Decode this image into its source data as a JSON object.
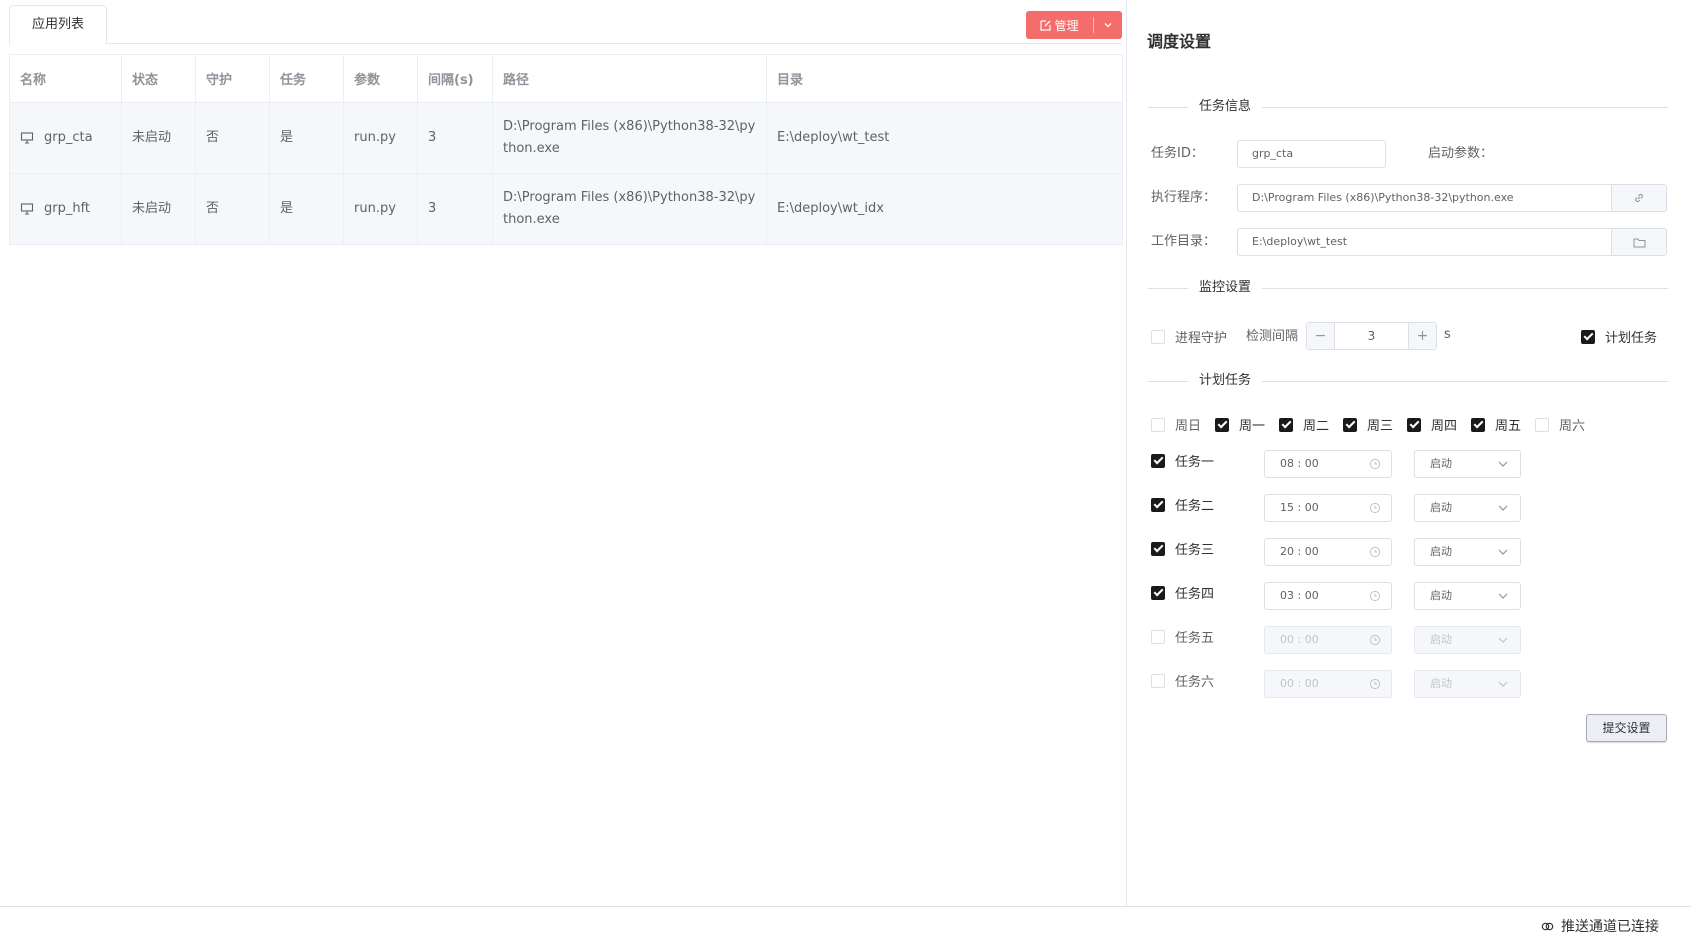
{
  "tabs": {
    "app_list": "应用列表"
  },
  "toolbar": {
    "manage_label": "管理"
  },
  "table": {
    "headers": [
      "名称",
      "状态",
      "守护",
      "任务",
      "参数",
      "间隔(s)",
      "路径",
      "目录"
    ],
    "rows": [
      {
        "name": "grp_cta",
        "status": "未启动",
        "guard": "否",
        "task": "是",
        "params": "run.py",
        "interval": "3",
        "path": "D:\\Program Files (x86)\\Python38-32\\python.exe",
        "dir": "E:\\deploy\\wt_test"
      },
      {
        "name": "grp_hft",
        "status": "未启动",
        "guard": "否",
        "task": "是",
        "params": "run.py",
        "interval": "3",
        "path": "D:\\Program Files (x86)\\Python38-32\\python.exe",
        "dir": "E:\\deploy\\wt_idx"
      }
    ]
  },
  "settings": {
    "title": "调度设置",
    "task_info": {
      "section": "任务信息",
      "id_label": "任务ID：",
      "id_value": "grp_cta",
      "args_label": "启动参数：",
      "exe_label": "执行程序：",
      "exe_value": "D:\\Program Files (x86)\\Python38-32\\python.exe",
      "dir_label": "工作目录：",
      "dir_value": "E:\\deploy\\wt_test"
    },
    "monitor": {
      "section": "监控设置",
      "guard_label": "进程守护",
      "guard_checked": false,
      "interval_label": "检测间隔",
      "interval_value": "3",
      "interval_unit": "s",
      "schedule_label": "计划任务",
      "schedule_checked": true
    },
    "schedule": {
      "section": "计划任务",
      "days": [
        {
          "label": "周日",
          "checked": false
        },
        {
          "label": "周一",
          "checked": true
        },
        {
          "label": "周二",
          "checked": true
        },
        {
          "label": "周三",
          "checked": true
        },
        {
          "label": "周四",
          "checked": true
        },
        {
          "label": "周五",
          "checked": true
        },
        {
          "label": "周六",
          "checked": false
        }
      ],
      "tasks": [
        {
          "label": "任务一",
          "checked": true,
          "time": "08 : 00",
          "action": "启动"
        },
        {
          "label": "任务二",
          "checked": true,
          "time": "15 : 00",
          "action": "启动"
        },
        {
          "label": "任务三",
          "checked": true,
          "time": "20 : 00",
          "action": "启动"
        },
        {
          "label": "任务四",
          "checked": true,
          "time": "03 : 00",
          "action": "启动"
        },
        {
          "label": "任务五",
          "checked": false,
          "time": "00 : 00",
          "action": "启动"
        },
        {
          "label": "任务六",
          "checked": false,
          "time": "00 : 00",
          "action": "启动"
        }
      ]
    },
    "submit_label": "提交设置"
  },
  "status_bar": {
    "connection": "推送通道已连接"
  },
  "colors": {
    "danger": "#f56c6c",
    "check": "#1a1a1a",
    "border": "#dcdfe6"
  }
}
